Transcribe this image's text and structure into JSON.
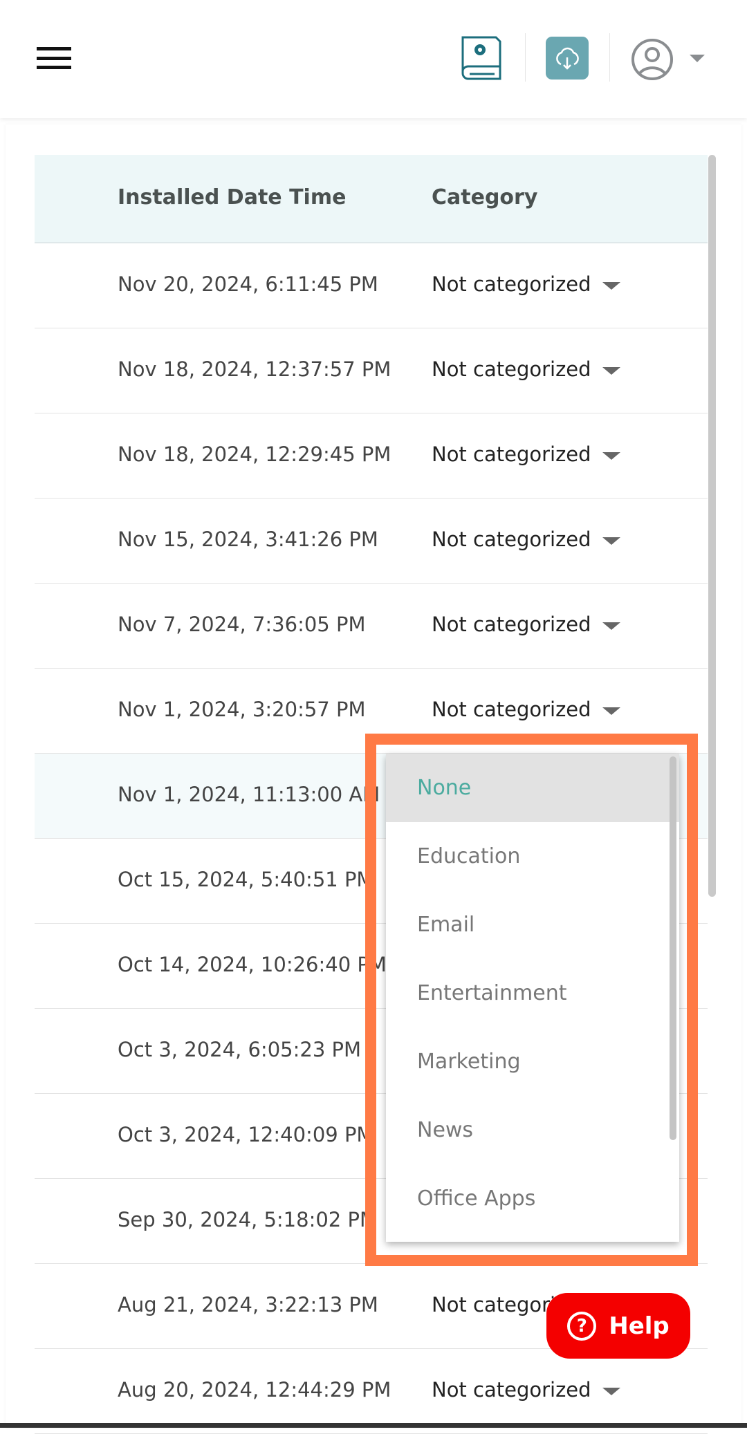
{
  "header": {
    "menu_icon": "hamburger-icon",
    "book_icon": "book-gear-icon",
    "cloud_icon": "cloud-download-icon",
    "avatar_icon": "user-circle-icon",
    "accent": "#6aa7b1"
  },
  "table": {
    "columns": [
      "Installed Date Time",
      "Category"
    ],
    "rows": [
      {
        "date": "Nov 20, 2024, 6:11:45 PM",
        "category": "Not categorized"
      },
      {
        "date": "Nov 18, 2024, 12:37:57 PM",
        "category": "Not categorized"
      },
      {
        "date": "Nov 18, 2024, 12:29:45 PM",
        "category": "Not categorized"
      },
      {
        "date": "Nov 15, 2024, 3:41:26 PM",
        "category": "Not categorized"
      },
      {
        "date": "Nov 7, 2024, 7:36:05 PM",
        "category": "Not categorized"
      },
      {
        "date": "Nov 1, 2024, 3:20:57 PM",
        "category": "Not categorized"
      },
      {
        "date": "Nov 1, 2024, 11:13:00 AM",
        "category": ""
      },
      {
        "date": "Oct 15, 2024, 5:40:51 PM",
        "category": ""
      },
      {
        "date": "Oct 14, 2024, 10:26:40 PM",
        "category": ""
      },
      {
        "date": "Oct 3, 2024, 6:05:23 PM",
        "category": ""
      },
      {
        "date": "Oct 3, 2024, 12:40:09 PM",
        "category": ""
      },
      {
        "date": "Sep 30, 2024, 5:18:02 PM",
        "category": ""
      },
      {
        "date": "Aug 21, 2024, 3:22:13 PM",
        "category": "Not categorized"
      },
      {
        "date": "Aug 20, 2024, 12:44:29 PM",
        "category": "Not categorized"
      }
    ]
  },
  "dropdown": {
    "selected": "None",
    "options": [
      "None",
      "Education",
      "Email",
      "Entertainment",
      "Marketing",
      "News",
      "Office Apps"
    ],
    "highlight_color": "#ff7a45"
  },
  "help": {
    "label": "Help",
    "color": "#f40000"
  }
}
